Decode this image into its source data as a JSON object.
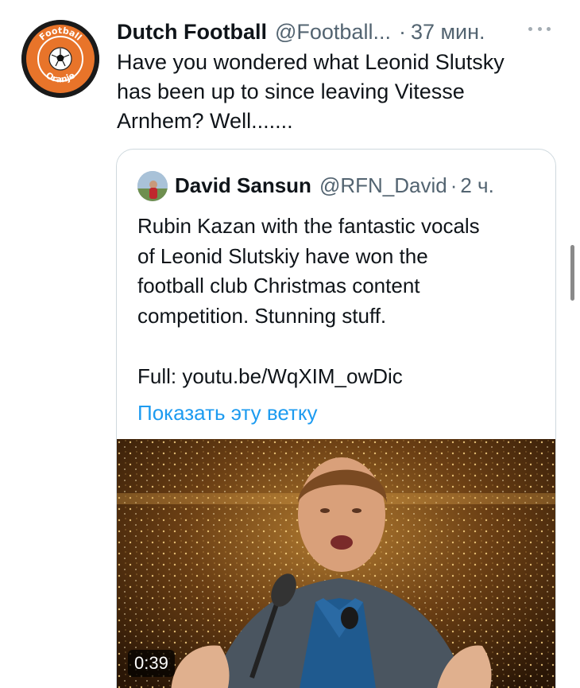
{
  "tweet": {
    "author_name": "Dutch Football",
    "author_handle": "@Football...",
    "separator": "·",
    "time": "37 мин.",
    "text": "Have you wondered what Leonid Slutsky\nhas been up to since leaving Vitesse\nArnhem? Well.......",
    "avatar_icon": "football-oranje-logo-icon",
    "avatar_logo_text": "Football Oranje",
    "more_icon": "more-dots-icon"
  },
  "quoted_tweet": {
    "author_name": "David Sansun",
    "author_handle": "@RFN_David",
    "separator": "·",
    "time": "2 ч.",
    "text": "Rubin Kazan with the fantastic vocals\nof Leonid Slutskiy have won the\nfootball club Christmas content\ncompetition. Stunning stuff.",
    "link_text": "Full: youtu.be/WqXIM_owDic",
    "show_thread_label": "Показать эту ветку",
    "media": {
      "type": "video",
      "duration": "0:39"
    }
  },
  "colors": {
    "link_blue": "#1d9bf0",
    "secondary_text": "#536471",
    "logo_orange": "#e8742a"
  }
}
